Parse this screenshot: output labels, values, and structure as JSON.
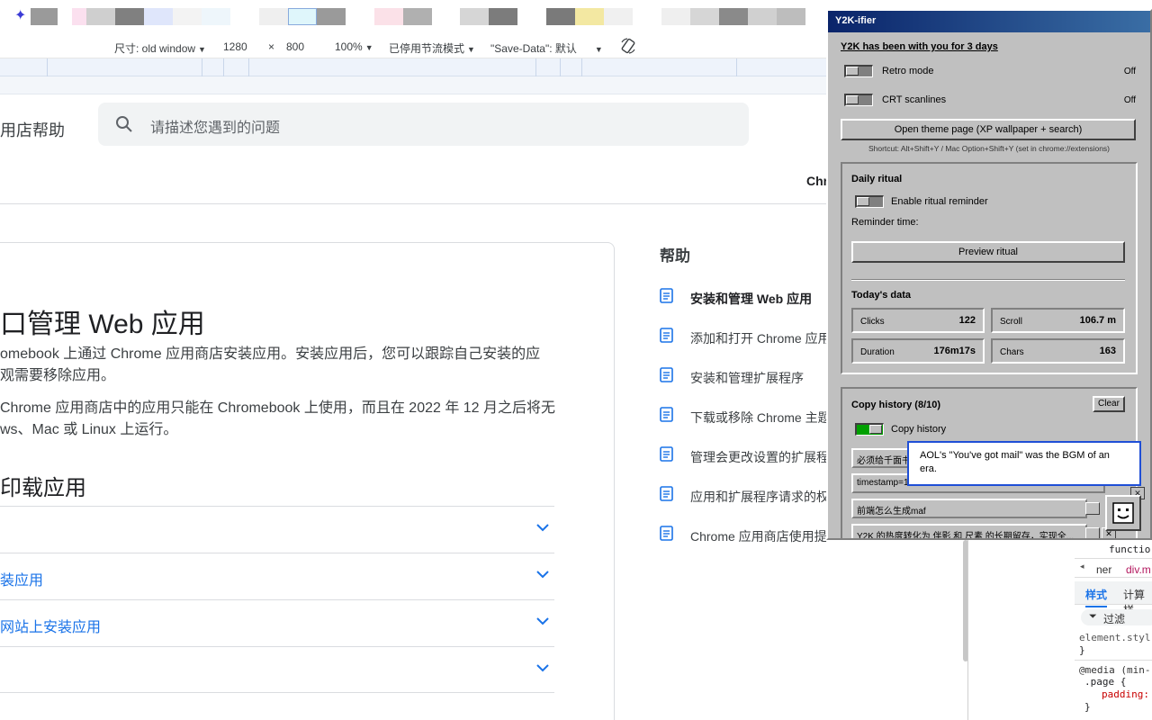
{
  "device_toolbar": {
    "dimensions_label": "尺寸: old window",
    "width": "1280",
    "times": "×",
    "height": "800",
    "zoom": "100%",
    "throttle": "已停用节流模式",
    "save_data_label": "\"Save-Data\": 默认"
  },
  "site": {
    "name": "用店帮助",
    "search_placeholder": "请描述您遇到的问题",
    "header_link": "Chr"
  },
  "article": {
    "title": "口管理 Web 应用",
    "para1_line1": "omebook 上通过 Chrome 应用商店安装应用。安装应用后，您可以跟踪自己安装的应",
    "para1_line2": "观需要移除应用。",
    "para2_line1": "Chrome 应用商店中的应用只能在 Chromebook 上使用，而且在 2022 年 12 月之后将无",
    "para2_line2": "ws、Mac 或 Linux 上运行。",
    "section_title": "印载应用",
    "accordion": [
      "",
      "装应用",
      "网站上安装应用",
      ""
    ]
  },
  "help_nav": {
    "title": "帮助",
    "items": [
      "安装和管理 Web 应用",
      "添加和打开 Chrome 应用",
      "安装和管理扩展程序",
      "下载或移除 Chrome 主题",
      "管理会更改设置的扩展程",
      "应用和扩展程序请求的权",
      "Chrome 应用商店使用提"
    ]
  },
  "devtools": {
    "line1": "functio",
    "breadcrumb_left": "ner",
    "breadcrumb_right": "div.m",
    "tab_styles": "样式",
    "tab_computed": "计算样",
    "filter": "过滤",
    "element_style": "element.styl",
    "brace_close": "}",
    "media": "@media (min-",
    "page_rule": ".page {",
    "padding": "padding:",
    "brace_close2": "}"
  },
  "y2k": {
    "title": "Y2K-ifier",
    "with_you": "Y2K has been with you for 3 days",
    "retro_mode": "Retro mode",
    "retro_state": "Off",
    "crt": "CRT scanlines",
    "crt_state": "Off",
    "theme_btn": "Open theme page (XP wallpaper + search)",
    "shortcut": "Shortcut: Alt+Shift+Y / Mac Option+Shift+Y (set in chrome://extensions)",
    "daily_ritual": "Daily ritual",
    "enable_reminder": "Enable ritual reminder",
    "reminder_time": "Reminder time:",
    "preview_btn": "Preview ritual",
    "todays_data": "Today's data",
    "stats": {
      "clicks_label": "Clicks",
      "clicks": "122",
      "scroll_label": "Scroll",
      "scroll": "106.7 m",
      "duration_label": "Duration",
      "duration": "176m17s",
      "chars_label": "Chars",
      "chars": "163"
    },
    "copy_history_title": "Copy history (8/10)",
    "clear_btn": "Clear",
    "copy_history_toggle": "Copy history",
    "history": [
      "必须给千面书",
      "timestamp=1",
      "前端怎么生成maf",
      "Y2K 的热度转化为 伴影 和 尺素 的长期留存，实现全..."
    ],
    "bubble": "AOL's \"You've got mail\" was the BGM of an era."
  }
}
